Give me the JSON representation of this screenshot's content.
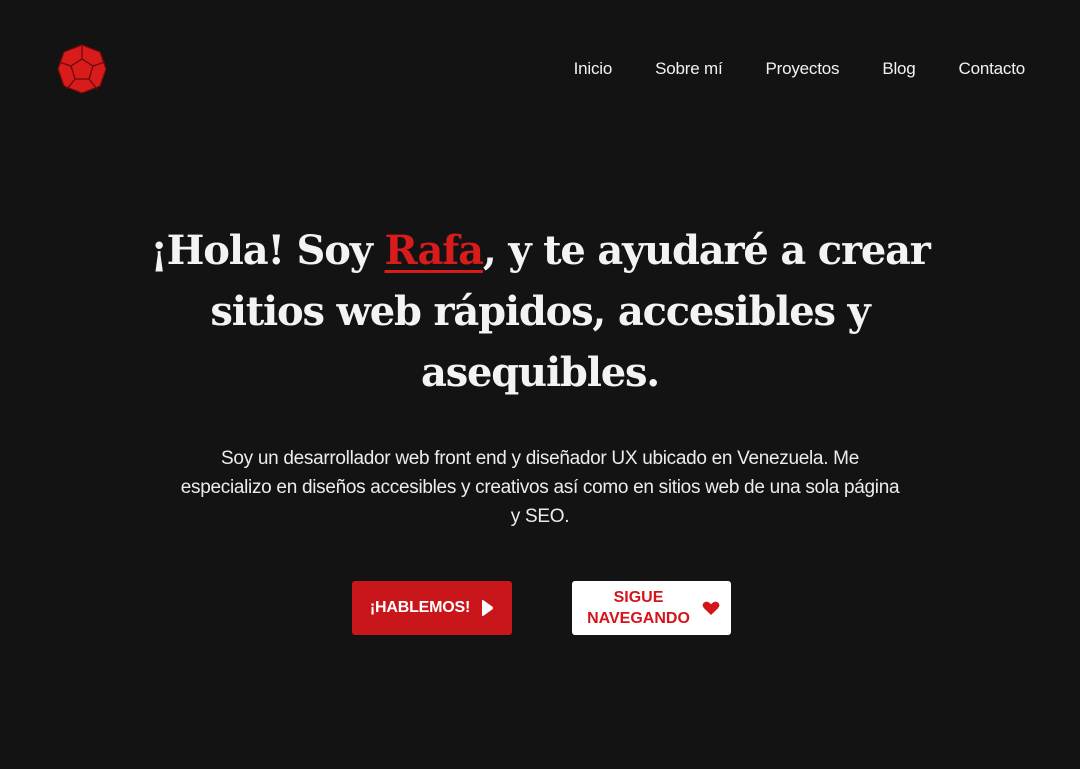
{
  "logo": {
    "icon": "dodecahedron-logo-icon",
    "color": "#d81b1b"
  },
  "nav": {
    "items": [
      "Inicio",
      "Sobre mí",
      "Proyectos",
      "Blog",
      "Contacto"
    ]
  },
  "hero": {
    "title_before": "¡Hola! Soy ",
    "title_name": "Rafa",
    "title_after": ", y te ayudaré a crear sitios web rápidos, accesibles y asequibles.",
    "description": "Soy un desarrollador web front end y diseñador UX ubicado en Venezuela. Me especializo en diseños accesibles y creativos así como en sitios web de una sola página  y SEO.",
    "accent_color": "#d81b1b"
  },
  "buttons": {
    "primary": {
      "label": "¡HABLEMOS!",
      "icon": "play-arrow-icon",
      "background": "#c8161b"
    },
    "secondary": {
      "label": "SIGUE NAVEGANDO",
      "icon": "heart-icon",
      "background": "#ffffff"
    }
  }
}
